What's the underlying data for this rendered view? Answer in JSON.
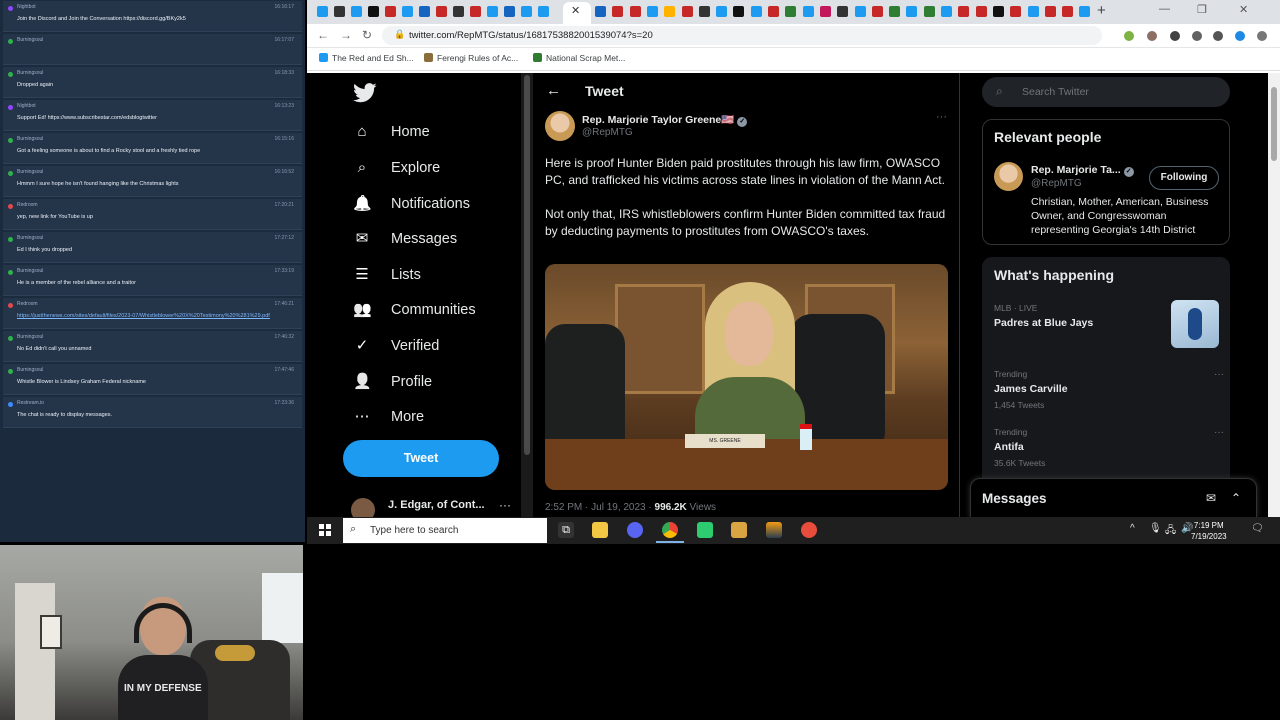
{
  "chat": {
    "messages": [
      {
        "user": "Nightbot",
        "time": "16:16:17",
        "text": "Join the Discord and Join the Conversation https://discord.gg/BKy2k5",
        "color": "#9147ff",
        "link": false
      },
      {
        "user": "Burningsoul",
        "time": "16:17:07",
        "text": "",
        "color": "#2fb24c",
        "link": false
      },
      {
        "user": "Burningsoul",
        "time": "16:18:33",
        "text": "Dropped again",
        "color": "#2fb24c",
        "link": false
      },
      {
        "user": "Nightbot",
        "time": "16:13:23",
        "text": "Support Ed! https://www.subscribestar.com/edsblogtwitter",
        "color": "#9147ff",
        "link": false
      },
      {
        "user": "Burningsoul",
        "time": "16:15:16",
        "text": "Got a feeling someone is about to find a Rocky stool and a freshly tied rope",
        "color": "#2fb24c",
        "link": false
      },
      {
        "user": "Burningsoul",
        "time": "16:16:52",
        "text": "Hmmm I sure hope he isn't found hanging like the Christmas lights",
        "color": "#2fb24c",
        "link": false
      },
      {
        "user": "Redroom",
        "time": "17:20:21",
        "text": "yep, new link for YouTube is up",
        "color": "#e34a4a",
        "link": false
      },
      {
        "user": "Burningsoul",
        "time": "17:27:12",
        "text": "Ed I think you dropped",
        "color": "#2fb24c",
        "link": false
      },
      {
        "user": "Burningsoul",
        "time": "17:33:19",
        "text": "He is a member of the rebel alliance and a traitor",
        "color": "#2fb24c",
        "link": false
      },
      {
        "user": "Redroom",
        "time": "17:46:21",
        "text": "https://justthenews.com/sites/default/files/2023-07/Whistleblower%20X%20Testimony%20%281%29.pdf",
        "color": "#e34a4a",
        "link": true
      },
      {
        "user": "Burningsoul",
        "time": "17:46:32",
        "text": "No Ed didn't call you unnamed",
        "color": "#2fb24c",
        "link": false
      },
      {
        "user": "Burningsoul",
        "time": "17:47:46",
        "text": "Whistle Blower is Lindsey Graham Federal nickname",
        "color": "#2fb24c",
        "link": false
      },
      {
        "user": "Restream.io",
        "time": "17:23:36",
        "text": "The chat is ready to display messages.",
        "color": "#3d8bff",
        "link": false
      }
    ]
  },
  "webcam": {
    "shirt_text": "IN MY DEFENSE"
  },
  "browser": {
    "url": "twitter.com/RepMTG/status/1681753882001539074?s=20",
    "bookmarks": [
      {
        "label": "The Red and Ed Sh...",
        "color": "#1d9bf0"
      },
      {
        "label": "Ferengi Rules of Ac...",
        "color": "#8a6d3b"
      },
      {
        "label": "National Scrap Met...",
        "color": "#2e7d32"
      }
    ]
  },
  "twitter": {
    "nav": [
      {
        "label": "Home",
        "icon": "home-icon",
        "glyph": "⌂"
      },
      {
        "label": "Explore",
        "icon": "search-icon",
        "glyph": "⌕"
      },
      {
        "label": "Notifications",
        "icon": "bell-icon",
        "glyph": "🔔"
      },
      {
        "label": "Messages",
        "icon": "envelope-icon",
        "glyph": "✉"
      },
      {
        "label": "Lists",
        "icon": "list-icon",
        "glyph": "☰"
      },
      {
        "label": "Communities",
        "icon": "people-icon",
        "glyph": "👥"
      },
      {
        "label": "Verified",
        "icon": "verified-badge-icon",
        "glyph": "✓"
      },
      {
        "label": "Profile",
        "icon": "person-icon",
        "glyph": "👤"
      },
      {
        "label": "More",
        "icon": "more-circle-icon",
        "glyph": "⋯"
      }
    ],
    "tweet_button": "Tweet",
    "account_name": "J. Edgar, of Cont...",
    "header_title": "Tweet",
    "author": {
      "name": "Rep. Marjorie Taylor Greene🇺🇸",
      "handle": "@RepMTG"
    },
    "tweet_paragraphs": [
      "Here is proof Hunter Biden paid prostitutes through his law firm, OWASCO PC, and trafficked his victims across state lines in violation of the Mann Act.",
      "Not only that, IRS whistleblowers confirm Hunter Biden committed tax fraud by deducting payments to prostitutes from OWASCO's taxes."
    ],
    "media_nameplate": "MS. GREENE",
    "meta_time": "2:52 PM · Jul 19, 2023 · ",
    "meta_views_count": "996.2K",
    "meta_views_label": " Views",
    "search_placeholder": "Search Twitter",
    "relevant_people": {
      "title": "Relevant people",
      "name": "Rep. Marjorie Ta...",
      "handle": "@RepMTG",
      "follow_label": "Following",
      "bio": "Christian, Mother, American, Business Owner, and Congresswoman representing Georgia's 14th District"
    },
    "whats_happening": {
      "title": "What's happening",
      "trends": [
        {
          "context": "MLB · LIVE",
          "title": "Padres at Blue Jays",
          "count": ""
        },
        {
          "context": "Trending",
          "title": "James Carville",
          "count": "1,454 Tweets"
        },
        {
          "context": "Trending",
          "title": "Antifa",
          "count": "35.6K Tweets"
        }
      ]
    },
    "messages_drawer": "Messages"
  },
  "taskbar": {
    "search_placeholder": "Type here to search",
    "time": "7:19 PM",
    "date": "7/19/2023"
  }
}
